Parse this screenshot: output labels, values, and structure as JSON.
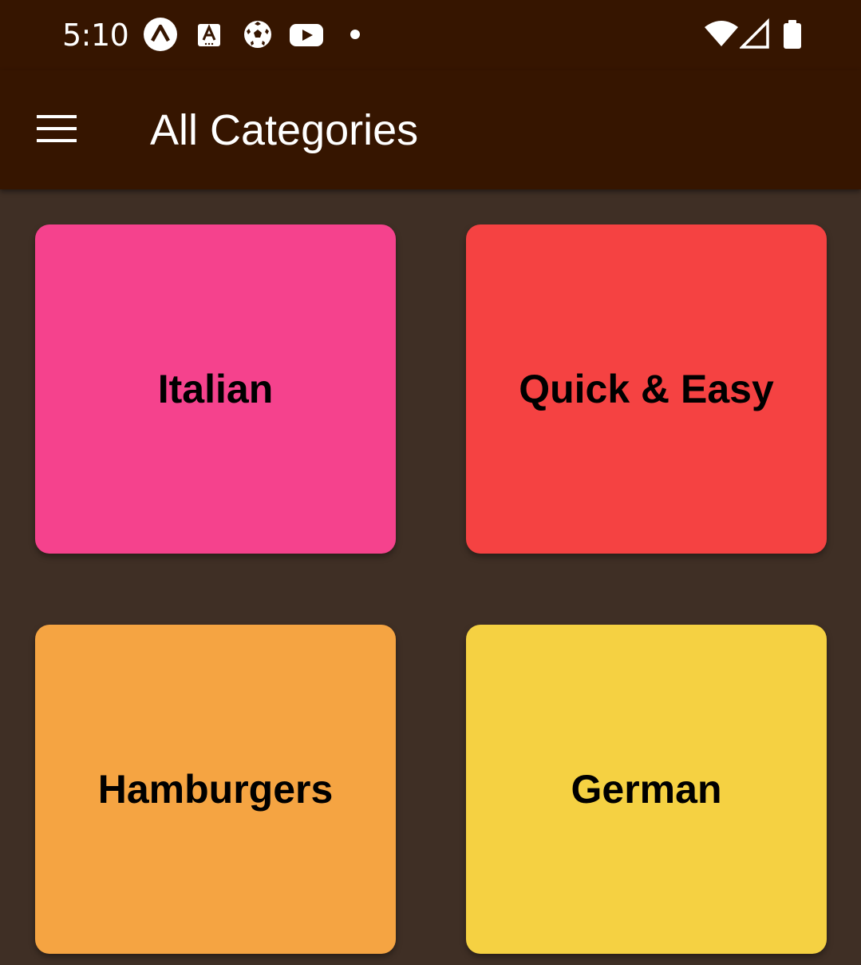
{
  "status_bar": {
    "time": "5:10",
    "notification_icons": [
      "expo-icon",
      "font-app-icon",
      "soccer-ball-icon",
      "youtube-icon",
      "more-dot-icon"
    ],
    "system_icons": [
      "wifi-icon",
      "cell-signal-icon",
      "battery-icon"
    ]
  },
  "app_bar": {
    "title": "All Categories",
    "menu_icon": "hamburger-menu-icon"
  },
  "categories": [
    {
      "label": "Italian",
      "color": "#f5428d"
    },
    {
      "label": "Quick & Easy",
      "color": "#f54242"
    },
    {
      "label": "Hamburgers",
      "color": "#f5a442"
    },
    {
      "label": "German",
      "color": "#f5d142"
    }
  ],
  "colors": {
    "header_background": "#361500",
    "screen_background": "#3f2f25",
    "header_text": "#ffffff",
    "tile_text": "#000000"
  }
}
